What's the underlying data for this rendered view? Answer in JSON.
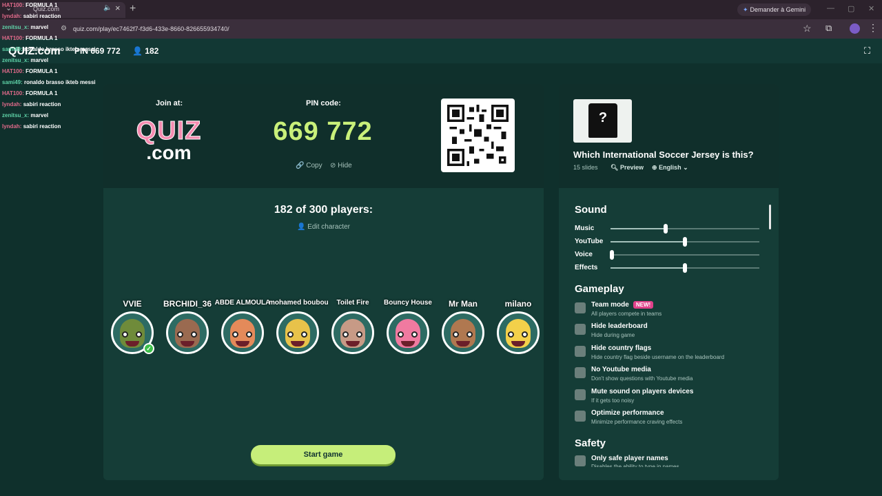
{
  "browser": {
    "tab_title": "Quiz.com",
    "gemini_label": "Demander à Gemini",
    "url": "quiz.com/play/ec7462f7-f3d6-433e-8660-826655934740/",
    "icons": [
      "search-icon",
      "mute-icon",
      "close-icon",
      "plus-icon",
      "star-icon",
      "extension-icon",
      "profile-icon",
      "menu-icon"
    ]
  },
  "topbar": {
    "logo": "QUIZ.com",
    "pin": "PIN 669 772",
    "players": "182"
  },
  "chat": [
    {
      "user": "HAT100:",
      "msg": "FORMULA 1"
    },
    {
      "user": "lyndah:",
      "msg": "sabiri reaction"
    },
    {
      "user": "zenitsu_x:",
      "msg": "marvel"
    },
    {
      "user": "HAT100:",
      "msg": "FORMULA 1"
    },
    {
      "user": "sami49:",
      "msg": "ronaldo brasso ikteb messi"
    },
    {
      "user": "zenitsu_x:",
      "msg": "marvel"
    },
    {
      "user": "HAT100:",
      "msg": "FORMULA 1"
    },
    {
      "user": "sami49:",
      "msg": "ronaldo brasso ikteb messi"
    },
    {
      "user": "HAT100:",
      "msg": "FORMULA 1"
    },
    {
      "user": "lyndah:",
      "msg": "sabiri reaction"
    },
    {
      "user": "zenitsu_x:",
      "msg": "marvel"
    },
    {
      "user": "lyndah:",
      "msg": "sabiri reaction"
    }
  ],
  "join": {
    "label": "Join at:",
    "logo_top": "QUIZ",
    "logo_bottom": ".com",
    "pin_label": "PIN code:",
    "pin": "669 772",
    "copy": "Copy",
    "hide": "Hide"
  },
  "lobby": {
    "title": "182 of 300 players:",
    "edit_character": "Edit character",
    "start": "Start game",
    "players": [
      {
        "name": "VVIE",
        "color": "#6f8b3a",
        "checked": true
      },
      {
        "name": "BRCHIDI_36",
        "color": "#9a6a50"
      },
      {
        "name": "ABDE ALMOULA",
        "color": "#e48a5a"
      },
      {
        "name": "mohamed boubou",
        "color": "#e8c24a"
      },
      {
        "name": "Toilet Fire",
        "color": "#c79a86"
      },
      {
        "name": "Bouncy House",
        "color": "#f07aa0"
      },
      {
        "name": "Mr Man",
        "color": "#b07850"
      },
      {
        "name": "milano",
        "color": "#f3d04a"
      }
    ]
  },
  "quiz": {
    "title": "Which International Soccer Jersey is this?",
    "slides": "15 slides",
    "preview": "Preview",
    "language": "English",
    "thumb_mark": "?"
  },
  "settings": {
    "sound_title": "Sound",
    "sliders": [
      {
        "label": "Music",
        "value": 0.37
      },
      {
        "label": "YouTube",
        "value": 0.5
      },
      {
        "label": "Voice",
        "value": 0.01
      },
      {
        "label": "Effects",
        "value": 0.5
      }
    ],
    "gameplay_title": "Gameplay",
    "options": [
      {
        "title": "Team mode",
        "sub": "All players compete in teams",
        "badge": "NEW!"
      },
      {
        "title": "Hide leaderboard",
        "sub": "Hide during game"
      },
      {
        "title": "Hide country flags",
        "sub": "Hide country flag beside username on the leaderboard"
      },
      {
        "title": "No Youtube media",
        "sub": "Don't show questions with Youtube media"
      },
      {
        "title": "Mute sound on players devices",
        "sub": "If it gets too noisy"
      },
      {
        "title": "Optimize performance",
        "sub": "Minimize performance craving effects"
      }
    ],
    "safety_title": "Safety",
    "safety_option": "Only safe player names",
    "safety_sub": "Disables the ability to type in names"
  }
}
